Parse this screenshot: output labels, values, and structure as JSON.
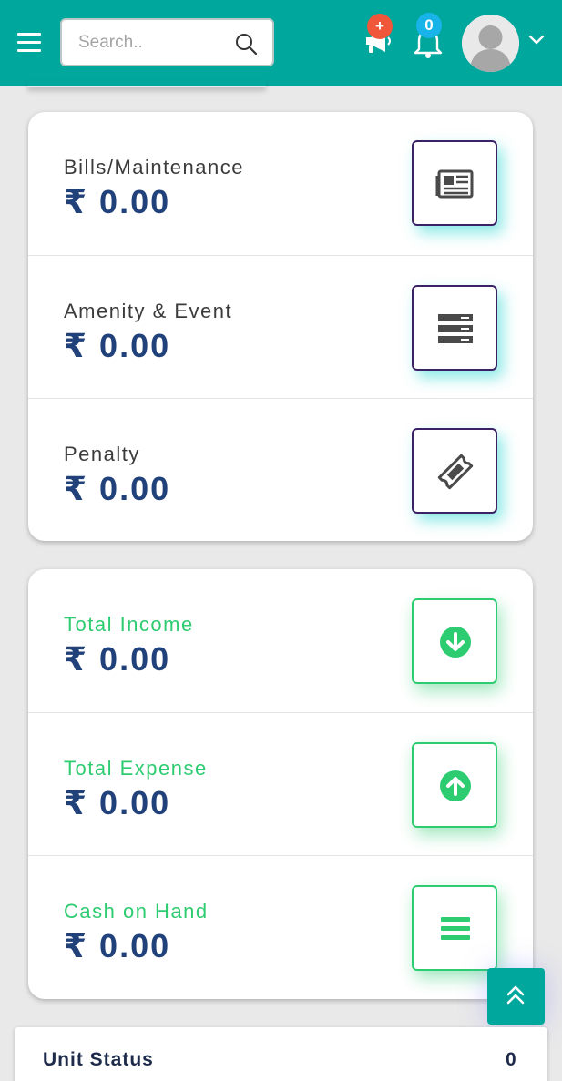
{
  "header": {
    "search_placeholder": "Search..",
    "announcement_badge": "+",
    "notification_count": "0"
  },
  "finance_card": {
    "rows": [
      {
        "label": "Bills/Maintenance",
        "value": "₹ 0.00",
        "icon": "newspaper-icon"
      },
      {
        "label": "Amenity & Event",
        "value": "₹ 0.00",
        "icon": "server-icon"
      },
      {
        "label": "Penalty",
        "value": "₹ 0.00",
        "icon": "ticket-icon"
      }
    ]
  },
  "summary_card": {
    "rows": [
      {
        "label": "Total Income",
        "value": "₹ 0.00",
        "icon": "arrow-circle-down-icon"
      },
      {
        "label": "Total Expense",
        "value": "₹ 0.00",
        "icon": "arrow-circle-up-icon"
      },
      {
        "label": "Cash on Hand",
        "value": "₹ 0.00",
        "icon": "bars-icon"
      }
    ]
  },
  "unit_status": {
    "title": "Unit Status",
    "count": "0"
  },
  "colors": {
    "header_bg": "#00a79d",
    "value_text": "#21417a",
    "green_accent": "#2ecc71",
    "purple_border": "#3b2266",
    "badge_orange": "#f0573a",
    "badge_blue": "#18b4e9"
  }
}
